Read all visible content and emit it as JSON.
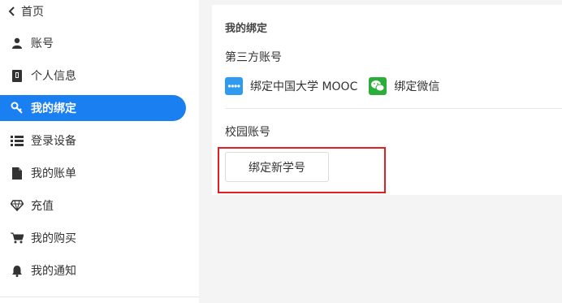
{
  "sidebar": {
    "home_label": "首页",
    "items": [
      {
        "label": "账号",
        "icon": "user-icon"
      },
      {
        "label": "个人信息",
        "icon": "id-card-icon"
      },
      {
        "label": "我的绑定",
        "icon": "key-icon",
        "active": true
      },
      {
        "label": "登录设备",
        "icon": "list-icon"
      },
      {
        "label": "我的账单",
        "icon": "document-icon"
      },
      {
        "label": "充值",
        "icon": "diamond-icon"
      },
      {
        "label": "我的购买",
        "icon": "cart-icon"
      },
      {
        "label": "我的通知",
        "icon": "bell-icon"
      }
    ]
  },
  "main": {
    "title": "我的绑定",
    "third_party_label": "第三方账号",
    "third_party": [
      {
        "label": "绑定中国大学 MOOC",
        "icon": "mooc-logo-icon",
        "color": "#2e9bf0"
      },
      {
        "label": "绑定微信",
        "icon": "wechat-icon",
        "color": "#2aae39"
      }
    ],
    "campus_label": "校园账号",
    "bind_button": "绑定新学号"
  },
  "colors": {
    "accent": "#1a7ff0",
    "highlight": "#e02020"
  }
}
